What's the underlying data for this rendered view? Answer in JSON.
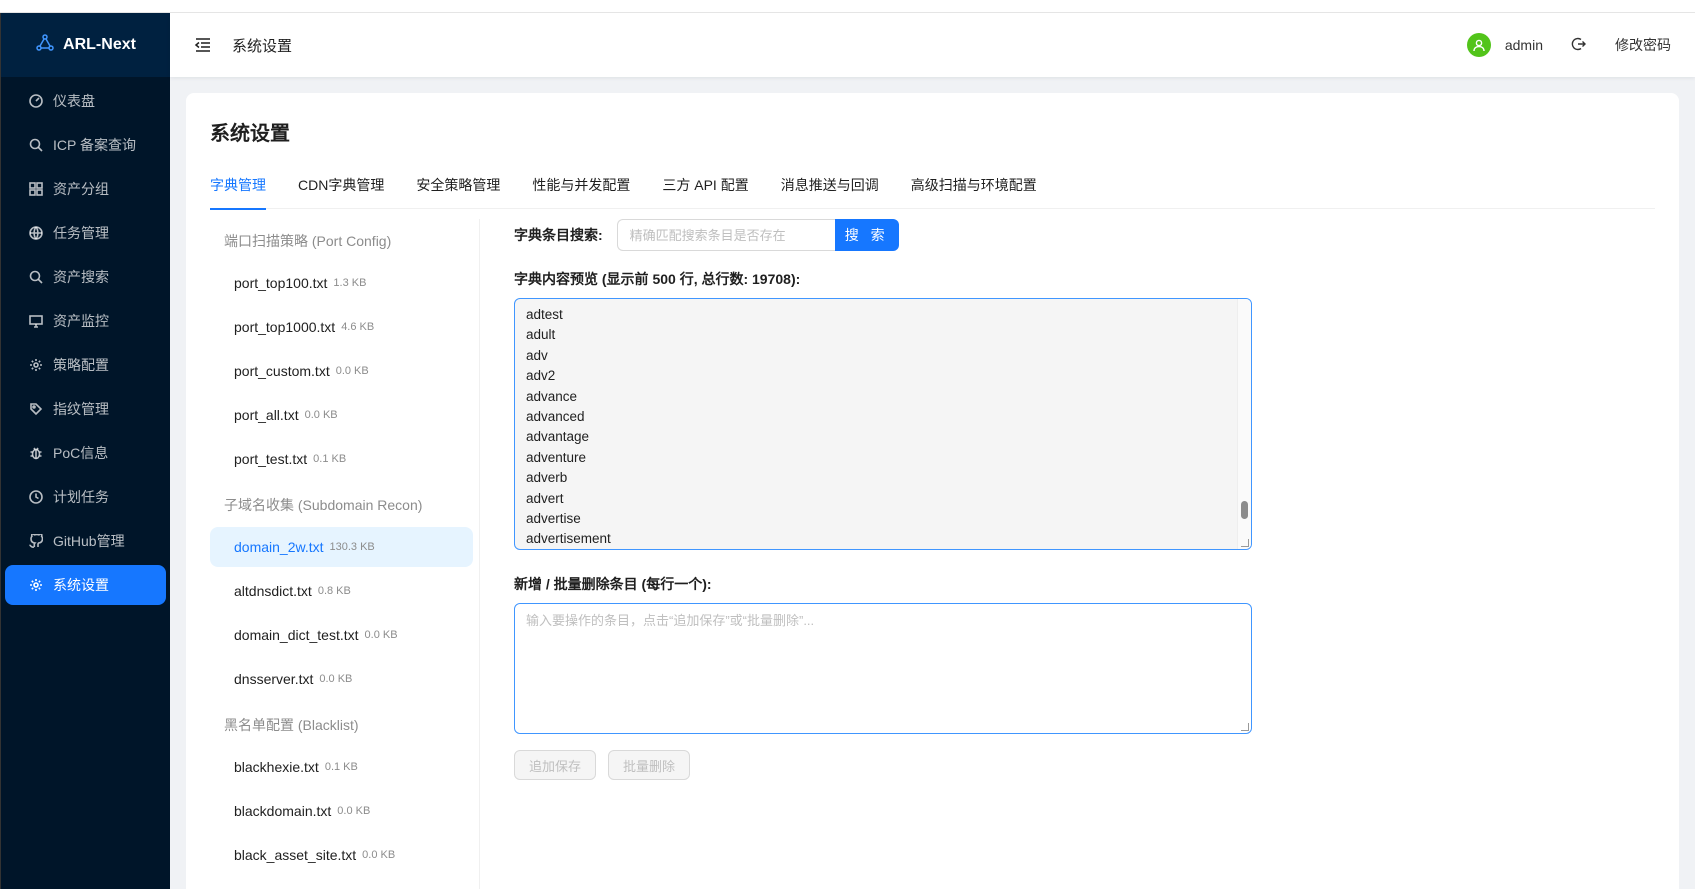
{
  "app": {
    "title": "ARL-Next"
  },
  "sidebar": {
    "items": [
      {
        "label": "仪表盘",
        "icon": "dashboard-icon"
      },
      {
        "label": "ICP 备案查询",
        "icon": "search-icon"
      },
      {
        "label": "资产分组",
        "icon": "grid-icon"
      },
      {
        "label": "任务管理",
        "icon": "globe-icon"
      },
      {
        "label": "资产搜索",
        "icon": "search-icon"
      },
      {
        "label": "资产监控",
        "icon": "monitor-icon"
      },
      {
        "label": "策略配置",
        "icon": "gear-icon"
      },
      {
        "label": "指纹管理",
        "icon": "tag-icon"
      },
      {
        "label": "PoC信息",
        "icon": "bug-icon"
      },
      {
        "label": "计划任务",
        "icon": "clock-icon"
      },
      {
        "label": "GitHub管理",
        "icon": "github-icon"
      },
      {
        "label": "系统设置",
        "icon": "gear-icon",
        "active": true
      }
    ]
  },
  "header": {
    "title": "系统设置",
    "username": "admin",
    "change_password": "修改密码"
  },
  "page": {
    "title": "系统设置",
    "tabs": [
      "字典管理",
      "CDN字典管理",
      "安全策略管理",
      "性能与并发配置",
      "三方 API 配置",
      "消息推送与回调",
      "高级扫描与环境配置"
    ],
    "active_tab": "字典管理"
  },
  "dict_groups": [
    {
      "title": "端口扫描策略 (Port Config)",
      "items": [
        {
          "name": "port_top100.txt",
          "size": "1.3 KB"
        },
        {
          "name": "port_top1000.txt",
          "size": "4.6 KB"
        },
        {
          "name": "port_custom.txt",
          "size": "0.0 KB"
        },
        {
          "name": "port_all.txt",
          "size": "0.0 KB"
        },
        {
          "name": "port_test.txt",
          "size": "0.1 KB"
        }
      ]
    },
    {
      "title": "子域名收集 (Subdomain Recon)",
      "items": [
        {
          "name": "domain_2w.txt",
          "size": "130.3 KB",
          "active": true
        },
        {
          "name": "altdnsdict.txt",
          "size": "0.8 KB"
        },
        {
          "name": "domain_dict_test.txt",
          "size": "0.0 KB"
        },
        {
          "name": "dnsserver.txt",
          "size": "0.0 KB"
        }
      ]
    },
    {
      "title": "黑名单配置 (Blacklist)",
      "items": [
        {
          "name": "blackhexie.txt",
          "size": "0.1 KB"
        },
        {
          "name": "blackdomain.txt",
          "size": "0.0 KB"
        },
        {
          "name": "black_asset_site.txt",
          "size": "0.0 KB"
        }
      ]
    }
  ],
  "editor": {
    "search_label": "字典条目搜索:",
    "search_placeholder": "精确匹配搜索条目是否存在",
    "search_button": "搜 索",
    "preview_label": "字典内容预览 (显示前 500 行, 总行数: 19708):",
    "preview_lines": [
      "adtest",
      "adult",
      "adv",
      "adv2",
      "advance",
      "advanced",
      "advantage",
      "adventure",
      "adverb",
      "advert",
      "advertise",
      "advertisement"
    ],
    "add_label": "新增 / 批量删除条目 (每行一个):",
    "add_placeholder": "输入要操作的条目，点击“追加保存”或“批量删除”...",
    "append_button": "追加保存",
    "delete_button": "批量删除"
  },
  "colors": {
    "sidebar_bg": "#001529",
    "primary": "#1677ff",
    "avatar": "#52c41a"
  }
}
